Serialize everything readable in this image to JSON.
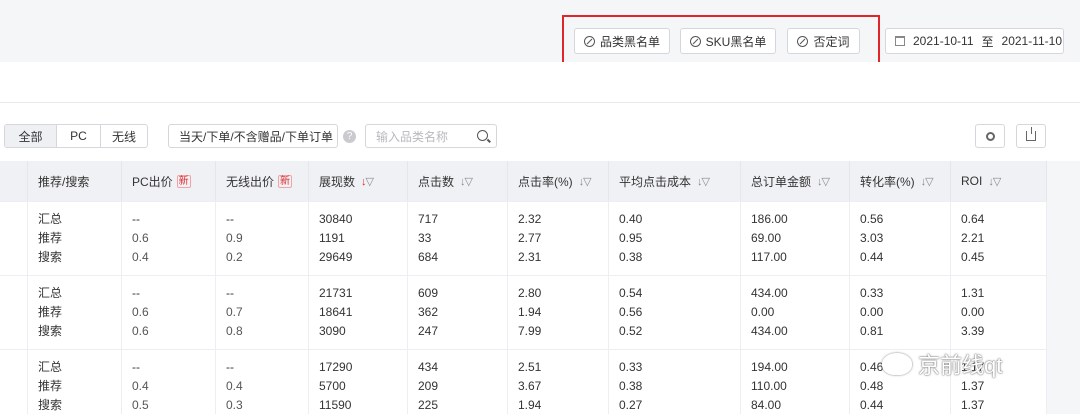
{
  "toolbar": {
    "btn_category_blacklist": "品类黑名单",
    "btn_sku_blacklist": "SKU黑名单",
    "btn_negative_words": "否定词",
    "date_start": "2021-10-11",
    "date_sep": "至",
    "date_end": "2021-11-10"
  },
  "filters": {
    "device_tabs": [
      "全部",
      "PC",
      "无线"
    ],
    "order_select": "当天/下单/不含赠品/下单订单",
    "help": "?",
    "search_placeholder": "输入品类名称"
  },
  "table": {
    "headers": [
      "推荐/搜索",
      "PC出价",
      "无线出价",
      "展现数",
      "点击数",
      "点击率(%)",
      "平均点击成本",
      "总订单金额",
      "转化率(%)",
      "ROI"
    ],
    "new_badge": "新",
    "rows": [
      [
        [
          "汇总",
          "推荐",
          "搜索"
        ],
        [
          "--",
          "0.6",
          "0.4"
        ],
        [
          "--",
          "0.9",
          "0.2"
        ],
        [
          "30840",
          "1191",
          "29649"
        ],
        [
          "717",
          "33",
          "684"
        ],
        [
          "2.32",
          "2.77",
          "2.31"
        ],
        [
          "0.40",
          "0.95",
          "0.38"
        ],
        [
          "186.00",
          "69.00",
          "117.00"
        ],
        [
          "0.56",
          "3.03",
          "0.44"
        ],
        [
          "0.64",
          "2.21",
          "0.45"
        ]
      ],
      [
        [
          "汇总",
          "推荐",
          "搜索"
        ],
        [
          "--",
          "0.6",
          "0.6"
        ],
        [
          "--",
          "0.7",
          "0.8"
        ],
        [
          "21731",
          "18641",
          "3090"
        ],
        [
          "609",
          "362",
          "247"
        ],
        [
          "2.80",
          "1.94",
          "7.99"
        ],
        [
          "0.54",
          "0.56",
          "0.52"
        ],
        [
          "434.00",
          "0.00",
          "434.00"
        ],
        [
          "0.33",
          "0.00",
          "0.81"
        ],
        [
          "1.31",
          "0.00",
          "3.39"
        ]
      ],
      [
        [
          "汇总",
          "推荐",
          "搜索"
        ],
        [
          "--",
          "0.4",
          "0.5"
        ],
        [
          "--",
          "0.4",
          "0.3"
        ],
        [
          "17290",
          "5700",
          "11590"
        ],
        [
          "434",
          "209",
          "225"
        ],
        [
          "2.51",
          "3.67",
          "1.94"
        ],
        [
          "0.33",
          "0.38",
          "0.27"
        ],
        [
          "194.00",
          "110.00",
          "84.00"
        ],
        [
          "0.46",
          "0.48",
          "0.44"
        ],
        [
          "1.17",
          "1.37",
          "1.37"
        ]
      ]
    ]
  },
  "watermark": "京前线qt"
}
